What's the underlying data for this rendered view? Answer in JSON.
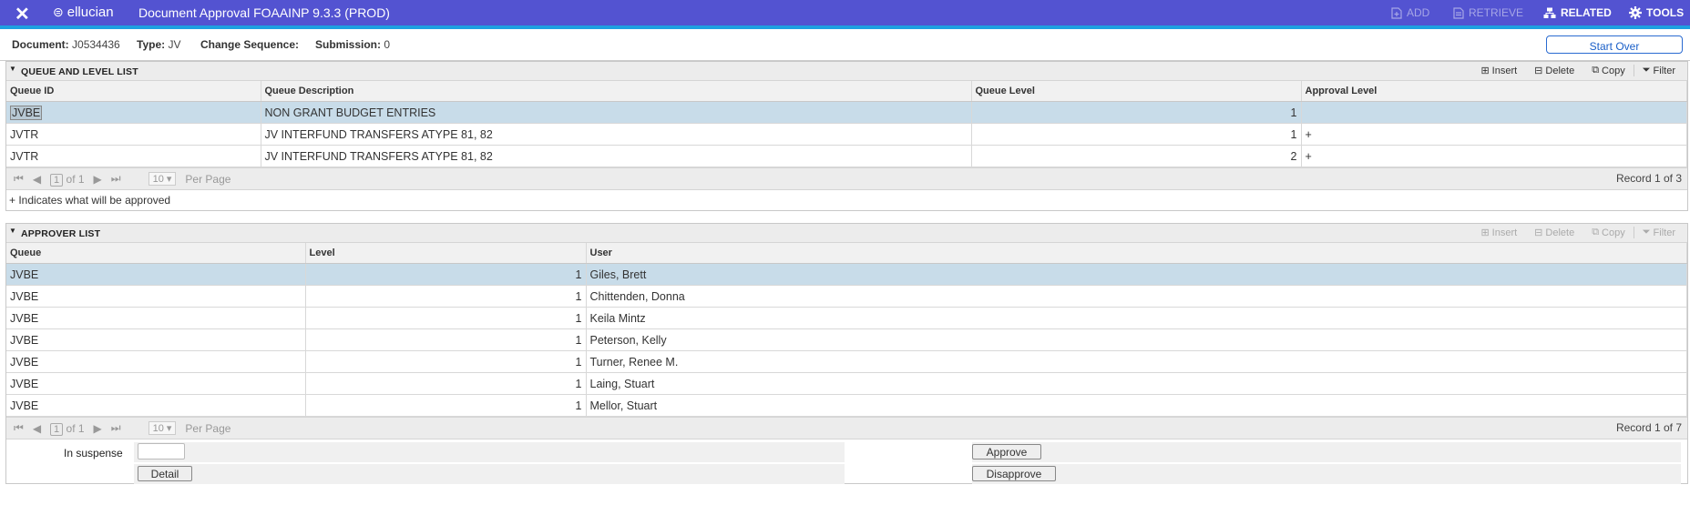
{
  "header": {
    "close_glyph": "✕",
    "logo_mark": "⊜",
    "logo_text": "ellucian",
    "title": "Document Approval FOAAINP 9.3.3 (PROD)",
    "add_label": "ADD",
    "retrieve_label": "RETRIEVE",
    "related_label": "RELATED",
    "tools_label": "TOOLS"
  },
  "info": {
    "document_label": "Document:",
    "document_value": "J0534436",
    "type_label": "Type:",
    "type_value": "JV",
    "change_seq_label": "Change Sequence:",
    "submission_label": "Submission:",
    "submission_value": "0",
    "start_over_label": "Start Over"
  },
  "queue_section": {
    "title": "QUEUE AND LEVEL LIST",
    "tools": {
      "insert": "Insert",
      "delete": "Delete",
      "copy": "Copy",
      "filter": "Filter"
    },
    "columns": [
      "Queue ID",
      "Queue Description",
      "Queue Level",
      "Approval Level"
    ],
    "rows": [
      {
        "queue_id": "JVBE",
        "description": "NON GRANT BUDGET ENTRIES",
        "level": "1",
        "approval": ""
      },
      {
        "queue_id": "JVTR",
        "description": "JV INTERFUND TRANSFERS ATYPE 81, 82",
        "level": "1",
        "approval": "+"
      },
      {
        "queue_id": "JVTR",
        "description": "JV INTERFUND TRANSFERS ATYPE 81, 82",
        "level": "2",
        "approval": "+"
      }
    ],
    "pager": {
      "page": "1",
      "of": "of 1",
      "per_page_value": "10",
      "per_page_label": "Per Page",
      "record": "Record 1 of 3"
    },
    "note": "+ Indicates what will be approved"
  },
  "approver_section": {
    "title": "APPROVER LIST",
    "tools": {
      "insert": "Insert",
      "delete": "Delete",
      "copy": "Copy",
      "filter": "Filter"
    },
    "columns": [
      "Queue",
      "Level",
      "User"
    ],
    "rows": [
      {
        "queue": "JVBE",
        "level": "1",
        "user": "Giles, Brett"
      },
      {
        "queue": "JVBE",
        "level": "1",
        "user": "Chittenden, Donna"
      },
      {
        "queue": "JVBE",
        "level": "1",
        "user": "Keila Mintz"
      },
      {
        "queue": "JVBE",
        "level": "1",
        "user": "Peterson, Kelly"
      },
      {
        "queue": "JVBE",
        "level": "1",
        "user": "Turner, Renee M."
      },
      {
        "queue": "JVBE",
        "level": "1",
        "user": "Laing, Stuart"
      },
      {
        "queue": "JVBE",
        "level": "1",
        "user": "Mellor, Stuart"
      }
    ],
    "pager": {
      "page": "1",
      "of": "of 1",
      "per_page_value": "10",
      "per_page_label": "Per Page",
      "record": "Record 1 of 7"
    }
  },
  "form": {
    "in_suspense_label": "In suspense",
    "in_suspense_value": "",
    "detail_label": "Detail",
    "approve_label": "Approve",
    "disapprove_label": "Disapprove"
  },
  "colors": {
    "header_bg": "#5353d1",
    "header_accent": "#1ea0e0",
    "selected_row": "#c8dce9",
    "start_over": "#2a6bd1"
  }
}
